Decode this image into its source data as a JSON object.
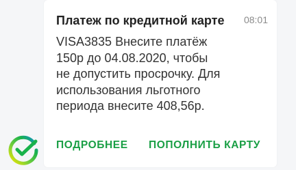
{
  "notification": {
    "title": "Платеж по кредитной карте",
    "time": "08:01",
    "message": "VISA3835 Внесите платёж\n150р до 04.08.2020, чтобы\nне допустить просрочку. Для\nиспользования льготного\nпериода внесите 408,56р.",
    "actions": {
      "more_label": "ПОДРОБНЕЕ",
      "topup_label": "ПОПОЛНИТЬ КАРТУ"
    }
  },
  "icons": {
    "app_logo": "sberbank-logo-icon"
  },
  "colors": {
    "accent": "#1a9f45",
    "card_bg": "#ffffff",
    "page_bg": "#f5f6f8",
    "time_text": "#8a8a8a"
  }
}
